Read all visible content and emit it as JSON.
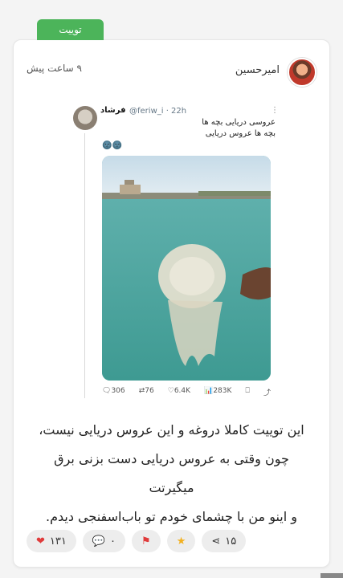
{
  "post": {
    "tag": "توییت",
    "author": "امیرحسین",
    "time": "۹ ساعت پیش",
    "text_line1": "این توییت کاملا دروغه و این عروس دریایی نیست،",
    "text_line2": "چون وقتی به عروس دریایی دست بزنی برق میگیرتت",
    "text_line3": "و اینو من با چشمای خودم تو باب‌اسفنجی دیدم."
  },
  "tweet": {
    "name": "فرشاد",
    "handle": "@feriw_i · 22h",
    "line1": "عروسی دریایی بچه ها",
    "line2": "بچه ها عروس دریایی",
    "emoji": "🌚🌚",
    "replies": "306",
    "retweets": "76",
    "likes": "6.4K",
    "views": "283K"
  },
  "actions": {
    "likes": "۱۳۱",
    "comments": "۰",
    "shares": "۱۵"
  },
  "colors": {
    "tag_green": "#4cb45a",
    "heart_red": "#e03b3b",
    "star_yellow": "#f2b01e"
  }
}
